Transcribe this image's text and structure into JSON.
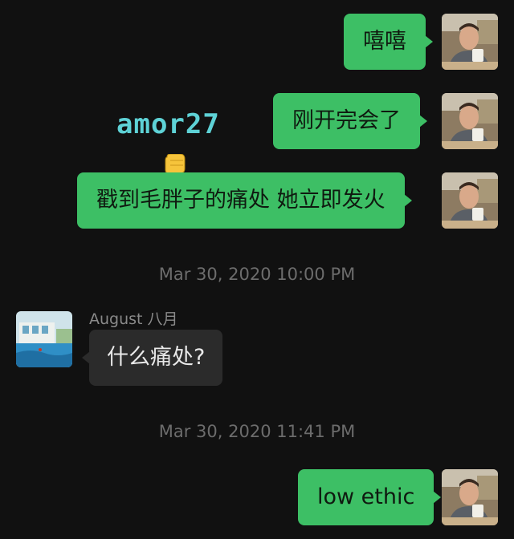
{
  "messages": [
    {
      "side": "out",
      "text": "嘻嘻"
    },
    {
      "side": "out",
      "text": "刚开完会了"
    },
    {
      "side": "out",
      "text": "戳到毛胖子的痛处 她立即发火"
    },
    {
      "side": "in",
      "sender": "August 八月",
      "text": "什么痛处?"
    },
    {
      "side": "out",
      "text": "low ethic"
    }
  ],
  "timestamps": [
    "Mar 30, 2020 10:00 PM",
    "Mar 30, 2020 11:41 PM"
  ],
  "watermark": "amor27",
  "icons": {
    "pointer": "pointing-down-hand-icon",
    "my_avatar": "man-with-mug-avatar",
    "other_avatar": "pool-house-avatar"
  },
  "colors": {
    "background": "#111111",
    "outgoing_bubble": "#3dbf65",
    "incoming_bubble": "#2b2b2b",
    "watermark": "#5ed2d6"
  }
}
